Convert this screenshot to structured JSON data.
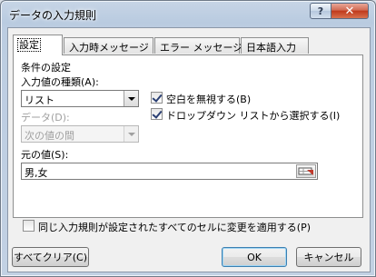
{
  "window": {
    "title": "データの入力規則",
    "help_label": "?",
    "close_label": "✕"
  },
  "tabs": [
    {
      "label": "設定",
      "active": true
    },
    {
      "label": "入力時メッセージ",
      "active": false
    },
    {
      "label": "エラー メッセージ",
      "active": false
    },
    {
      "label": "日本語入力",
      "active": false
    }
  ],
  "settings": {
    "criteria_heading": "条件の設定",
    "allow_label": "入力値の種類(A):",
    "allow_value": "リスト",
    "data_label": "データ(D):",
    "data_value": "次の値の間",
    "ignore_blank_label": "空白を無視する(B)",
    "ignore_blank_checked": true,
    "in_cell_dropdown_label": "ドロップダウン リストから選択する(I)",
    "in_cell_dropdown_checked": true,
    "source_label": "元の値(S):",
    "source_value": "男,女",
    "apply_all_label": "同じ入力規則が設定されたすべてのセルに変更を適用する(P)",
    "apply_all_checked": false
  },
  "buttons": {
    "clear_all": "すべてクリア(C)",
    "ok": "OK",
    "cancel": "キャンセル"
  }
}
